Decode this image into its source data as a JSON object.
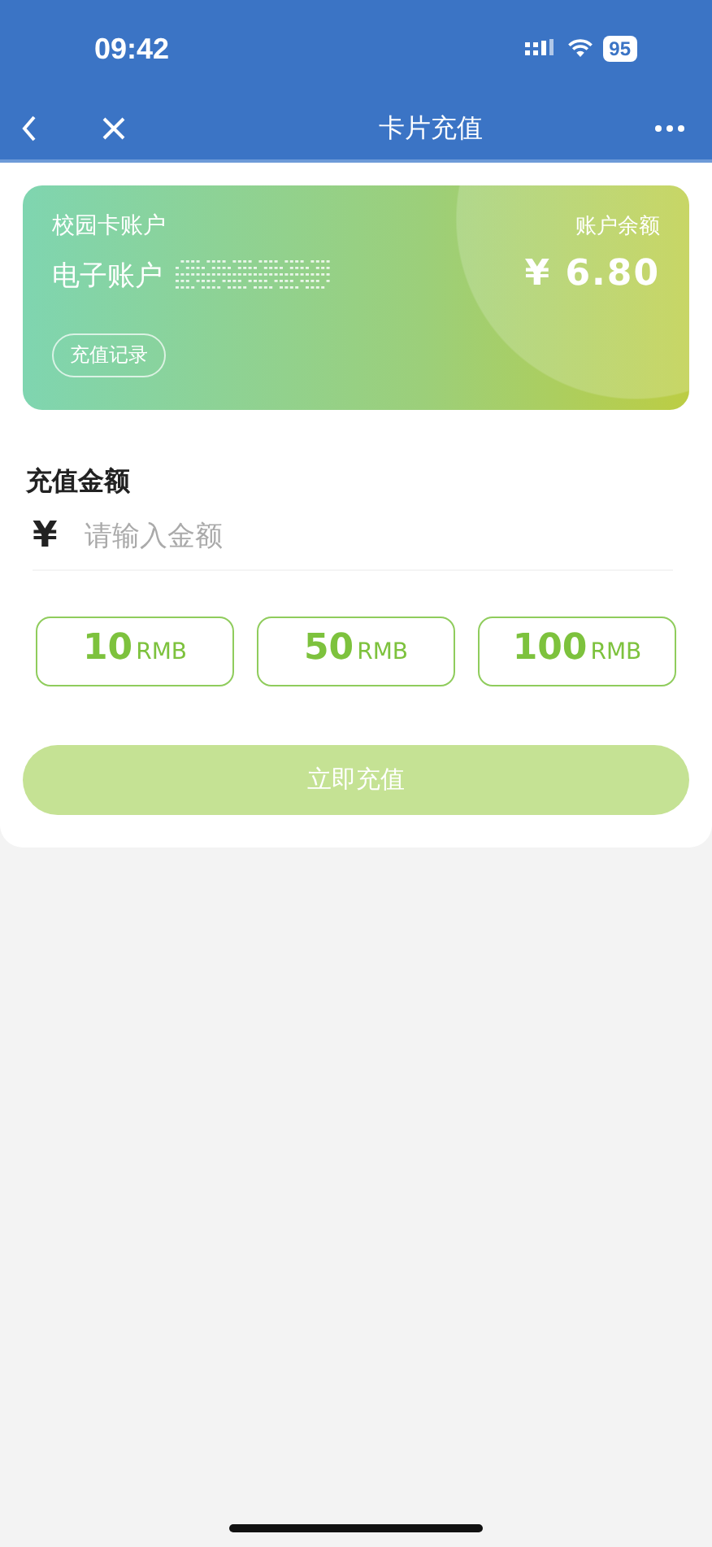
{
  "status_bar": {
    "time": "09:42",
    "battery": "95"
  },
  "nav": {
    "title": "卡片充值"
  },
  "card": {
    "account_type": "校园卡账户",
    "account_name": "电子账户",
    "balance_label": "账户余额",
    "balance": "¥ 6.80",
    "history_button": "充值记录"
  },
  "amount": {
    "label": "充值金额",
    "currency": "¥",
    "placeholder": "请输入金额"
  },
  "presets": [
    {
      "value": "10",
      "unit": "RMB",
      "selected": false
    },
    {
      "value": "50",
      "unit": "RMB",
      "selected": false
    },
    {
      "value": "100",
      "unit": "RMB",
      "selected": false
    }
  ],
  "submit": {
    "label": "立即充值",
    "disabled": true
  }
}
